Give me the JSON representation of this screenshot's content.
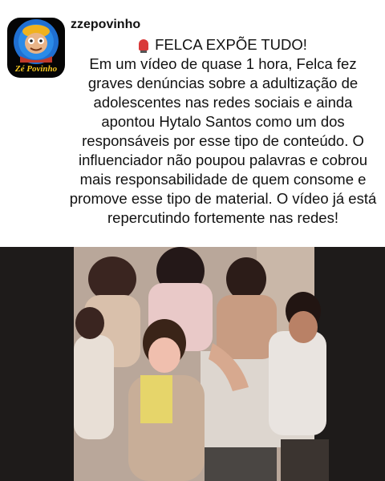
{
  "post": {
    "username": "zzepovinho",
    "avatar": {
      "brand_text": "Zé Povinho",
      "icon": "cartoon-man-avatar"
    },
    "headline": "FELCA EXPÕE TUDO!",
    "headline_icon": "siren-icon",
    "body": "Em um vídeo de quase 1 hora, Felca fez graves denúncias sobre a adultização de adolescentes nas redes sociais e ainda apontou Hytalo Santos como um dos responsáveis por esse tipo de conteúdo. O influenciador não poupou palavras e cobrou mais responsabilidade de quem consome e promove esse tipo de material. O vídeo já está repercutindo fortemente nas redes!"
  },
  "video": {
    "description_icon": "video-frame"
  },
  "colors": {
    "background": "#ffffff",
    "text": "#111111",
    "siren": "#d93a3a"
  }
}
